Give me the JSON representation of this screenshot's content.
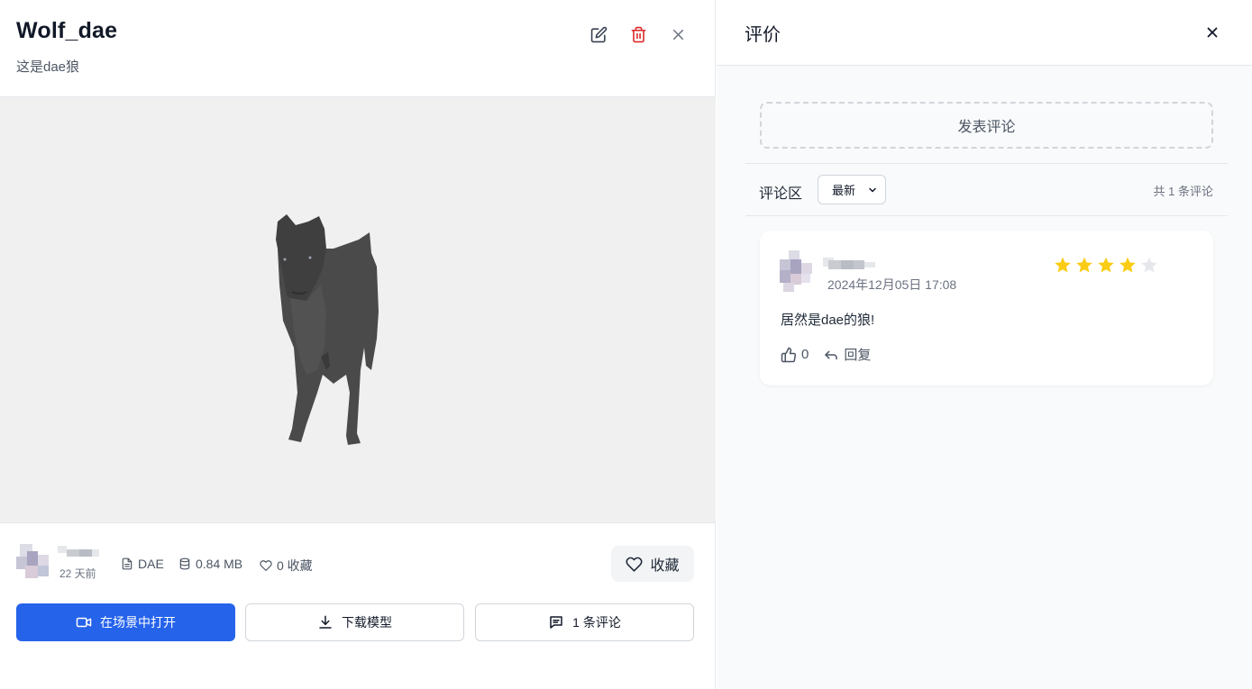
{
  "model": {
    "title": "Wolf_dae",
    "description": "这是dae狼",
    "time_ago": "22 天前",
    "format": "DAE",
    "size": "0.84 MB",
    "favorites": "0 收藏",
    "favorite_button": "收藏"
  },
  "actions": {
    "open_in_scene": "在场景中打开",
    "download": "下载模型",
    "comments": "1 条评论"
  },
  "reviews": {
    "title": "评价",
    "post_comment": "发表评论",
    "section_label": "评论区",
    "sort_selected": "最新",
    "total": "共 1 条评论",
    "items": [
      {
        "date": "2024年12月05日 17:08",
        "rating": 4,
        "rating_max": 5,
        "text": "居然是dae的狼!",
        "likes": "0",
        "reply_label": "回复"
      }
    ]
  },
  "colors": {
    "primary": "#2563eb",
    "danger": "#dc2626",
    "star": "#facc15",
    "star_empty": "#e5e7eb"
  }
}
